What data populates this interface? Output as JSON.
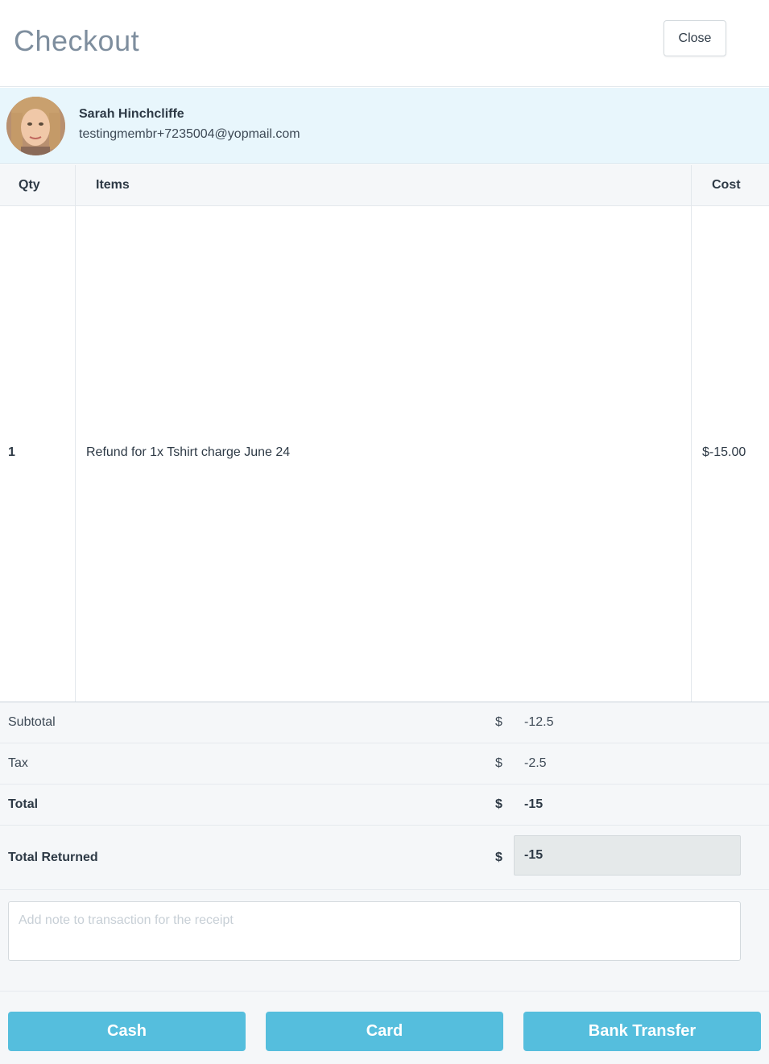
{
  "header": {
    "title": "Checkout",
    "close_label": "Close"
  },
  "member": {
    "name": "Sarah Hinchcliffe",
    "email": "testingmembr+7235004@yopmail.com"
  },
  "table": {
    "columns": {
      "qty": "Qty",
      "items": "Items",
      "cost": "Cost"
    },
    "rows": [
      {
        "qty": "1",
        "item": "Refund for 1x Tshirt charge June 24",
        "cost": "$-15.00"
      }
    ]
  },
  "totals": {
    "currency": "$",
    "subtotal": {
      "label": "Subtotal",
      "value": "-12.5"
    },
    "tax": {
      "label": "Tax",
      "value": "-2.5"
    },
    "total": {
      "label": "Total",
      "value": "-15"
    },
    "returned": {
      "label": "Total Returned",
      "value": "-15"
    }
  },
  "note": {
    "placeholder": "Add note to transaction for the receipt",
    "value": ""
  },
  "payment": {
    "cash": "Cash",
    "card": "Card",
    "bank": "Bank Transfer"
  },
  "colors": {
    "accent": "#55bedd",
    "member_bg": "#e8f6fc",
    "title": "#7e8e9e"
  }
}
